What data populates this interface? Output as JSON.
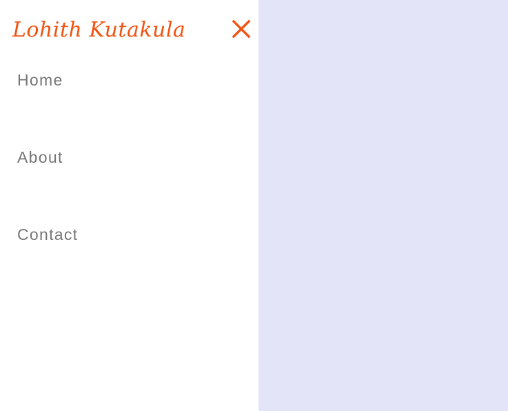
{
  "brand": {
    "name": "Lohith Kutakula"
  },
  "colors": {
    "accent": "#f2520f",
    "nav_text": "#757575",
    "drawer_bg": "#ffffff",
    "backdrop_bg": "#e4e4f8"
  },
  "close_button": {
    "icon": "close-icon"
  },
  "nav": {
    "items": [
      {
        "label": "Home"
      },
      {
        "label": "About"
      },
      {
        "label": "Contact"
      }
    ]
  }
}
